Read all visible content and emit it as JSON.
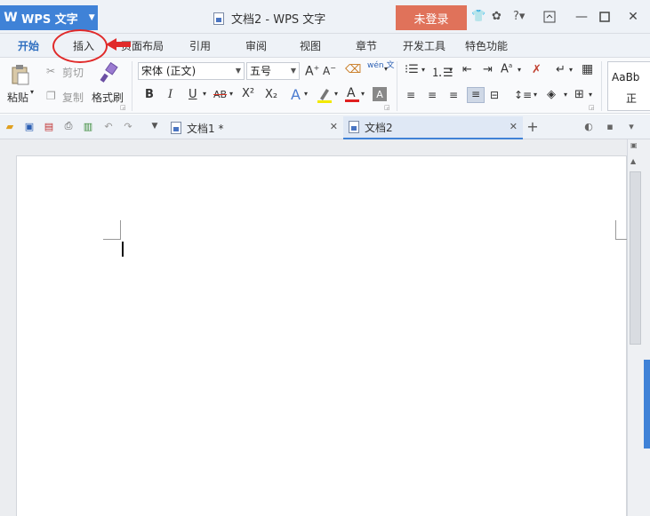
{
  "titlebar": {
    "app_name": "WPS 文字",
    "document_title": "文档2 - WPS 文字",
    "login_label": "未登录",
    "help_label": "?"
  },
  "tabs": [
    {
      "label": "开始",
      "active": true
    },
    {
      "label": "插入",
      "active": false
    },
    {
      "label": "页面布局",
      "active": false
    },
    {
      "label": "引用",
      "active": false
    },
    {
      "label": "审阅",
      "active": false
    },
    {
      "label": "视图",
      "active": false
    },
    {
      "label": "章节",
      "active": false
    },
    {
      "label": "开发工具",
      "active": false
    },
    {
      "label": "特色功能",
      "active": false
    }
  ],
  "ribbon": {
    "paste_label": "粘贴",
    "cut_label": "剪切",
    "copy_label": "复制",
    "format_painter_label": "格式刷",
    "font_name": "宋体 (正文)",
    "font_size": "五号",
    "style_preview": "AaBb",
    "style_name": "正",
    "bold": "B",
    "italic": "I",
    "underline": "U",
    "strike": "AB",
    "superscript": "X²",
    "subscript": "X₂",
    "phonetic": "wén 文"
  },
  "doc_tabs": [
    {
      "label": "文档1 *",
      "active": false
    },
    {
      "label": "文档2",
      "active": true
    }
  ],
  "colors": {
    "accent": "#3f82d7",
    "login": "#e0725a",
    "annotation": "#e02a2a"
  }
}
